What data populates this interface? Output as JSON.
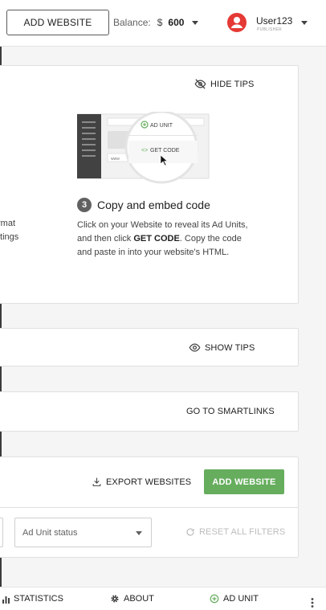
{
  "header": {
    "add_website_label": "ADD WEBSITE",
    "balance_label": "Balance:",
    "currency": "$",
    "balance_value": "600",
    "user_name": "User123",
    "user_role": "PUBLISHER"
  },
  "tips": {
    "hide_tips_label": "HIDE TIPS",
    "illustration": {
      "ad_unit_label": "AD UNIT",
      "get_code_label": "GET CODE",
      "www_label": "www"
    },
    "step_number": "3",
    "step_title": "Copy and embed code",
    "step_text_1": "Click on your Website to reveal its Ad Units,",
    "step_text_2a": "and then click ",
    "step_text_2b": "GET CODE",
    "step_text_2c": ". Copy the code",
    "step_text_3": "and paste in into your website's HTML.",
    "cut_line_1": "rmat",
    "cut_line_2": "ttings"
  },
  "show_tips_label": "SHOW TIPS",
  "smartlinks_label": "GO TO SMARTLINKS",
  "websites": {
    "export_label": "EXPORT WEBSITES",
    "add_label": "ADD WEBSITE",
    "ad_unit_status_label": "Ad Unit status",
    "reset_filters_label": "RESET ALL FILTERS"
  },
  "bottom_nav": {
    "statistics_label": "STATISTICS",
    "about_label": "ABOUT",
    "ad_unit_label": "AD UNIT"
  },
  "colors": {
    "primary_green": "#66ad5e",
    "avatar_red": "#e53935",
    "disabled_text": "#bdbdbd"
  },
  "icons": [
    "eye-off-icon",
    "eye-icon",
    "download-icon",
    "refresh-icon",
    "bar-chart-icon",
    "gear-icon",
    "add-circle-icon",
    "more-vert-icon",
    "person-icon",
    "caret-down-icon"
  ]
}
